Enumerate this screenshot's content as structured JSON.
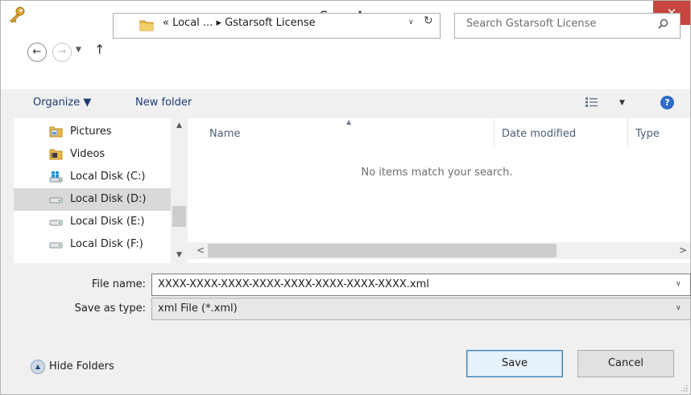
{
  "window": {
    "title": "Save As",
    "close_glyph": "✕"
  },
  "nav": {
    "back_glyph": "←",
    "forward_glyph": "→",
    "recent_glyph": "▼",
    "up_glyph": "↑",
    "breadcrumb": "« Local ... ▸ Gstarsoft License",
    "address_dropdown_glyph": "∨",
    "refresh_glyph": "↻",
    "search_placeholder": "Search Gstarsoft License"
  },
  "toolbar": {
    "organize_label": "Organize ▼",
    "new_folder_label": "New folder",
    "view_dropdown_glyph": "▼",
    "help_glyph": "?"
  },
  "sidebar": {
    "scroll_up_glyph": "▲",
    "scroll_down_glyph": "▼",
    "items": [
      {
        "label": "Pictures",
        "icon": "pictures-folder-icon",
        "selected": false
      },
      {
        "label": "Videos",
        "icon": "videos-folder-icon",
        "selected": false
      },
      {
        "label": "Local Disk (C:)",
        "icon": "windows-drive-icon",
        "selected": false
      },
      {
        "label": "Local Disk (D:)",
        "icon": "drive-icon",
        "selected": true
      },
      {
        "label": "Local Disk (E:)",
        "icon": "drive-icon",
        "selected": false
      },
      {
        "label": "Local Disk (F:)",
        "icon": "drive-icon",
        "selected": false
      }
    ]
  },
  "filelist": {
    "columns": [
      "Name",
      "Date modified",
      "Type"
    ],
    "sort_glyph": "▲",
    "empty_message": "No items match your search.",
    "scroll_left_glyph": "<",
    "scroll_right_glyph": ">"
  },
  "form": {
    "file_name_label": "File name:",
    "file_name_value": "XXXX-XXXX-XXXX-XXXX-XXXX-XXXX-XXXX-XXXX.xml",
    "save_type_label": "Save as type:",
    "save_type_value": "xml File (*.xml)",
    "dropdown_glyph": "∨"
  },
  "footer": {
    "hide_folders_glyph": "▲",
    "hide_folders_label": "Hide Folders",
    "save_label": "Save",
    "cancel_label": "Cancel"
  },
  "colors": {
    "close_button": "#c7463f",
    "accent": "#2f6cc7",
    "selection": "#d9d9d9"
  }
}
